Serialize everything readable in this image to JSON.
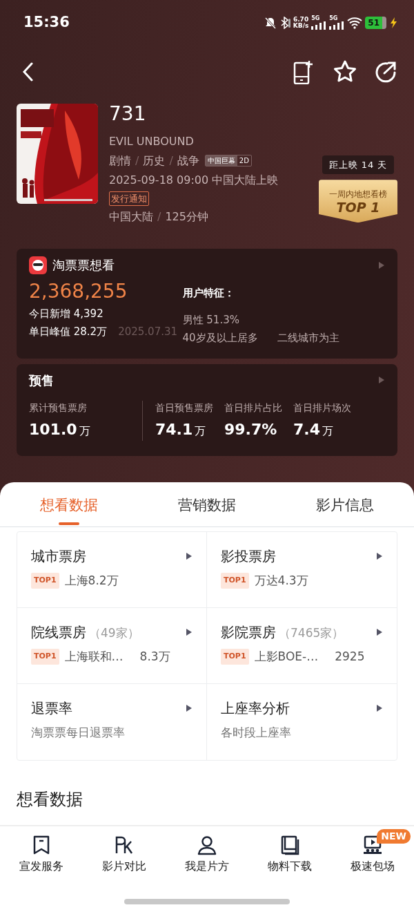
{
  "status_bar": {
    "time": "15:36",
    "speed": "6.70",
    "speed_unit": "KB/s",
    "networks": [
      "5G",
      "5G"
    ],
    "battery": "51"
  },
  "movie": {
    "title": "731",
    "english_title": "EVIL UNBOUND",
    "genres": [
      "剧情",
      "历史",
      "战争"
    ],
    "separator": "/",
    "formats": [
      "中国巨幕",
      "2D"
    ],
    "release": "2025-09-18 09:00 中国大陆上映",
    "notice": "发行通知",
    "region": "中国大陆",
    "duration": "125分钟",
    "countdown": "距上映 14 天",
    "rank_label": "一周内地想看榜",
    "rank_value": "TOP 1"
  },
  "want_card": {
    "title": "淘票票想看",
    "total": "2,368,255",
    "today": "今日新增 4,392",
    "peak": "单日峰值 28.2万",
    "peak_date": "2025.07.31",
    "traits_title": "用户特征：",
    "traits": [
      "男性 51.3%",
      "40岁及以上居多",
      "二线城市为主"
    ]
  },
  "presale": {
    "title": "预售",
    "stats": [
      {
        "label": "累计预售票房",
        "value": "101.0",
        "unit": "万"
      },
      {
        "label": "首日预售票房",
        "value": "74.1",
        "unit": "万"
      },
      {
        "label": "首日排片占比",
        "value": "99.7%"
      },
      {
        "label": "首日排片场次",
        "value": "7.4",
        "unit": "万"
      }
    ]
  },
  "tabs": [
    {
      "label": "想看数据",
      "selected": true
    },
    {
      "label": "营销数据",
      "selected": false
    },
    {
      "label": "影片信息",
      "selected": false
    }
  ],
  "grid": [
    {
      "kind": "ranking",
      "title": "城市票房",
      "tag": "TOP1",
      "top": "上海8.2万"
    },
    {
      "kind": "ranking",
      "title": "影投票房",
      "tag": "TOP1",
      "top": "万达4.3万"
    },
    {
      "kind": "ranking",
      "title": "院线票房",
      "count": "（49家）",
      "tag": "TOP1",
      "top": "上海联和…",
      "top_value": "8.3万"
    },
    {
      "kind": "ranking",
      "title": "影院票房",
      "count": "（7465家）",
      "tag": "TOP1",
      "top": "上影BOE-…",
      "top_value": "2925"
    },
    {
      "kind": "description",
      "title": "退票率",
      "subtitle": "淘票票每日退票率"
    },
    {
      "kind": "description",
      "title": "上座率分析",
      "subtitle": "各时段上座率"
    }
  ],
  "section_title": "想看数据",
  "bottom_nav": [
    {
      "label": "宣发服务"
    },
    {
      "label": "影片对比"
    },
    {
      "label": "我是片方"
    },
    {
      "label": "物料下载"
    },
    {
      "label": "极速包场",
      "badge": "NEW"
    }
  ]
}
